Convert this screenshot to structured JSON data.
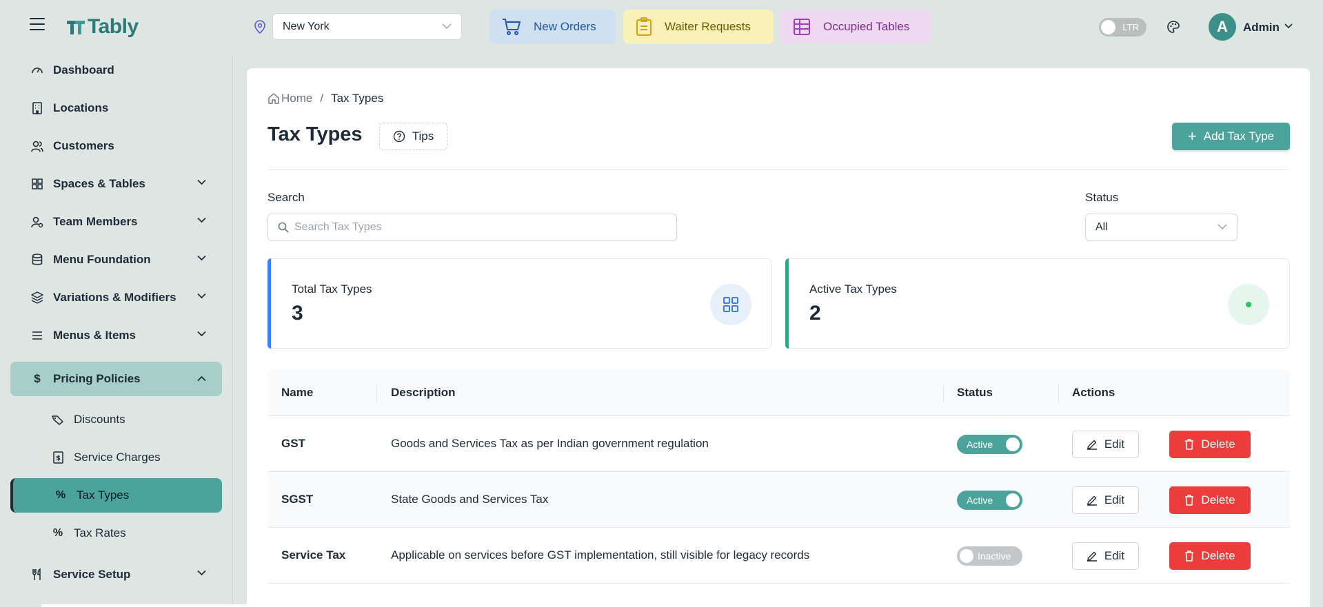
{
  "brand": {
    "name": "Tably"
  },
  "location": {
    "selected": "New York"
  },
  "quick_actions": {
    "new_orders": "New Orders",
    "waiter_requests": "Waiter Requests",
    "occupied_tables": "Occupied Tables"
  },
  "header": {
    "direction_toggle": "LTR",
    "avatar_initial": "A",
    "user_name": "Admin"
  },
  "sidebar": {
    "items": [
      {
        "label": "Dashboard"
      },
      {
        "label": "Locations"
      },
      {
        "label": "Customers"
      },
      {
        "label": "Spaces & Tables"
      },
      {
        "label": "Team Members"
      },
      {
        "label": "Menu Foundation"
      },
      {
        "label": "Variations & Modifiers"
      },
      {
        "label": "Menus & Items"
      },
      {
        "label": "Pricing Policies"
      },
      {
        "label": "Discounts"
      },
      {
        "label": "Service Charges"
      },
      {
        "label": "Tax Types"
      },
      {
        "label": "Tax Rates"
      },
      {
        "label": "Service Setup"
      }
    ]
  },
  "breadcrumb": {
    "home": "Home",
    "separator": "/",
    "current": "Tax Types"
  },
  "page": {
    "title": "Tax Types",
    "tips_label": "Tips",
    "add_label": "Add Tax Type"
  },
  "filters": {
    "search_label": "Search",
    "search_placeholder": "Search Tax Types",
    "status_label": "Status",
    "status_value": "All"
  },
  "stats": {
    "total": {
      "title": "Total Tax Types",
      "value": "3"
    },
    "active": {
      "title": "Active Tax Types",
      "value": "2"
    }
  },
  "table": {
    "headers": {
      "name": "Name",
      "description": "Description",
      "status": "Status",
      "actions": "Actions"
    },
    "edit_label": "Edit",
    "delete_label": "Delete",
    "rows": [
      {
        "name": "GST",
        "description": "Goods and Services Tax as per Indian government regulation",
        "status": "Active"
      },
      {
        "name": "SGST",
        "description": "State Goods and Services Tax",
        "status": "Active"
      },
      {
        "name": "Service Tax",
        "description": "Applicable on services before GST implementation, still visible for legacy records",
        "status": "Inactive"
      }
    ]
  },
  "colors": {
    "primary": "#4ca39b",
    "danger": "#ec3d3d",
    "total_accent": "#3b82f6",
    "active_accent": "#10b981"
  }
}
